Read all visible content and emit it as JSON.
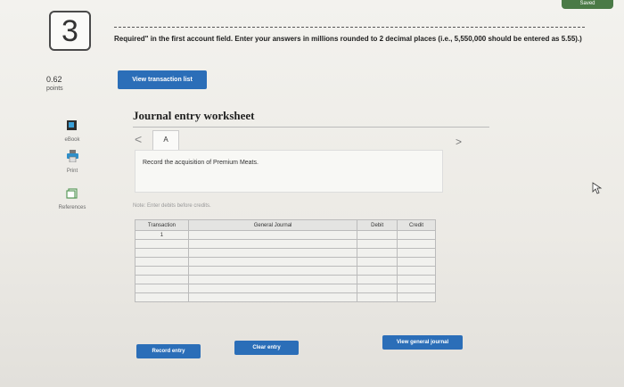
{
  "header": {
    "saved_label": "Saved",
    "question_number": "3",
    "instructions": "Required\" in the first account field. Enter your answers in millions rounded to 2 decimal places (i.e., 5,550,000 should be entered as 5.55).)"
  },
  "sidebar": {
    "points_value": "0.62",
    "points_label": "points",
    "tools": [
      {
        "label": "eBook",
        "icon": "book-icon"
      },
      {
        "label": "Print",
        "icon": "printer-icon"
      },
      {
        "label": "References",
        "icon": "references-icon"
      }
    ]
  },
  "actions": {
    "view_transaction_list": "View transaction list"
  },
  "worksheet": {
    "title": "Journal entry worksheet",
    "prev": "<",
    "next": ">",
    "tab_label": "A",
    "description": "Record the acquisition of Premium Meats.",
    "note": "Note: Enter debits before credits.",
    "columns": [
      "Transaction",
      "General Journal",
      "Debit",
      "Credit"
    ],
    "rows": [
      {
        "transaction": "1"
      },
      {
        "transaction": ""
      },
      {
        "transaction": ""
      },
      {
        "transaction": ""
      },
      {
        "transaction": ""
      },
      {
        "transaction": ""
      },
      {
        "transaction": ""
      },
      {
        "transaction": ""
      }
    ],
    "buttons": {
      "record": "Record entry",
      "clear": "Clear entry",
      "view_general": "View general journal"
    }
  },
  "colors": {
    "primary_button": "#2b6eb8",
    "saved_badge": "#4a7a46"
  }
}
